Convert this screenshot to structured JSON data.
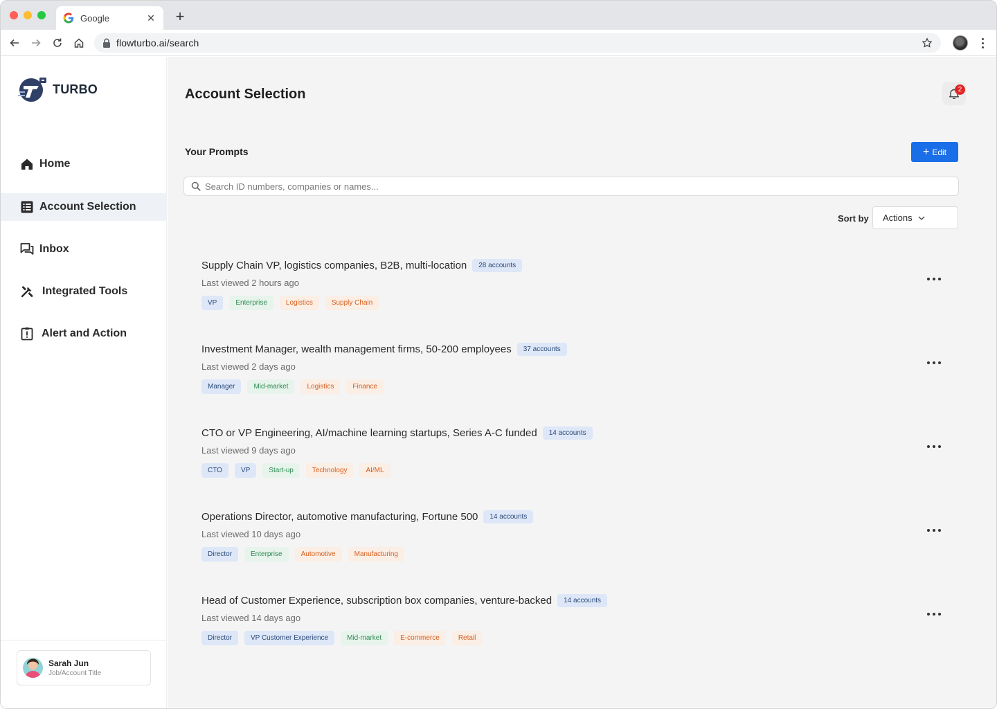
{
  "browser": {
    "tab_title": "Google",
    "url": "flowturbo.ai/search"
  },
  "sidebar": {
    "logo_text": "TURBO",
    "items": [
      {
        "label": "Home",
        "icon": "home-icon",
        "active": false
      },
      {
        "label": "Account Selection",
        "icon": "list-icon",
        "active": true
      },
      {
        "label": "Inbox",
        "icon": "chat-icon",
        "active": false
      },
      {
        "label": "Integrated Tools",
        "icon": "tools-icon",
        "active": false
      },
      {
        "label": "Alert and Action",
        "icon": "alert-icon",
        "active": false
      }
    ],
    "user": {
      "name": "Sarah Jun",
      "title": "Job/Account Title"
    }
  },
  "main": {
    "title": "Account Selection",
    "notification_count": "2",
    "section_title": "Your Prompts",
    "edit_label": "Edit",
    "search_placeholder": "Search ID numbers, companies or names...",
    "sort_label": "Sort by",
    "sort_value": "Actions",
    "prompts": [
      {
        "title": "Supply Chain VP, logistics companies, B2B, multi-location",
        "count": "28 accounts",
        "last_viewed": "Last viewed 2 hours ago",
        "tags": [
          {
            "text": "VP",
            "color": "blue"
          },
          {
            "text": "Enterprise",
            "color": "green"
          },
          {
            "text": "Logistics",
            "color": "orange"
          },
          {
            "text": "Supply Chain",
            "color": "orange"
          }
        ]
      },
      {
        "title": "Investment Manager, wealth management firms, 50-200 employees",
        "count": "37 accounts",
        "last_viewed": "Last viewed 2 days ago",
        "tags": [
          {
            "text": "Manager",
            "color": "blue"
          },
          {
            "text": "Mid-market",
            "color": "green"
          },
          {
            "text": "Logistics",
            "color": "orange"
          },
          {
            "text": "Finance",
            "color": "orange"
          }
        ]
      },
      {
        "title": "CTO or VP Engineering, AI/machine learning startups, Series A-C funded",
        "count": "14 accounts",
        "last_viewed": "Last viewed 9 days ago",
        "tags": [
          {
            "text": "CTO",
            "color": "blue"
          },
          {
            "text": "VP",
            "color": "blue"
          },
          {
            "text": "Start-up",
            "color": "green"
          },
          {
            "text": "Technology",
            "color": "orange"
          },
          {
            "text": "AI/ML",
            "color": "orange"
          }
        ]
      },
      {
        "title": "Operations Director, automotive manufacturing, Fortune 500",
        "count": "14 accounts",
        "last_viewed": "Last viewed 10 days ago",
        "tags": [
          {
            "text": "Director",
            "color": "blue"
          },
          {
            "text": "Enterprise",
            "color": "green"
          },
          {
            "text": "Automotive",
            "color": "orange"
          },
          {
            "text": "Manufacturing",
            "color": "orange"
          }
        ]
      },
      {
        "title": "Head of Customer Experience, subscription box companies, venture-backed",
        "count": "14 accounts",
        "last_viewed": "Last viewed 14 days ago",
        "tags": [
          {
            "text": "Director",
            "color": "blue"
          },
          {
            "text": "VP Customer Experience",
            "color": "blue"
          },
          {
            "text": "Mid-market",
            "color": "green"
          },
          {
            "text": "E-commerce",
            "color": "orange"
          },
          {
            "text": "Retail",
            "color": "orange"
          }
        ]
      }
    ]
  },
  "colors": {
    "accent": "#1a6ee8",
    "badge_red": "#e02424",
    "tag_blue_bg": "#dde7f7",
    "tag_green_bg": "#e7f4ec",
    "tag_orange_bg": "#faeee5"
  }
}
